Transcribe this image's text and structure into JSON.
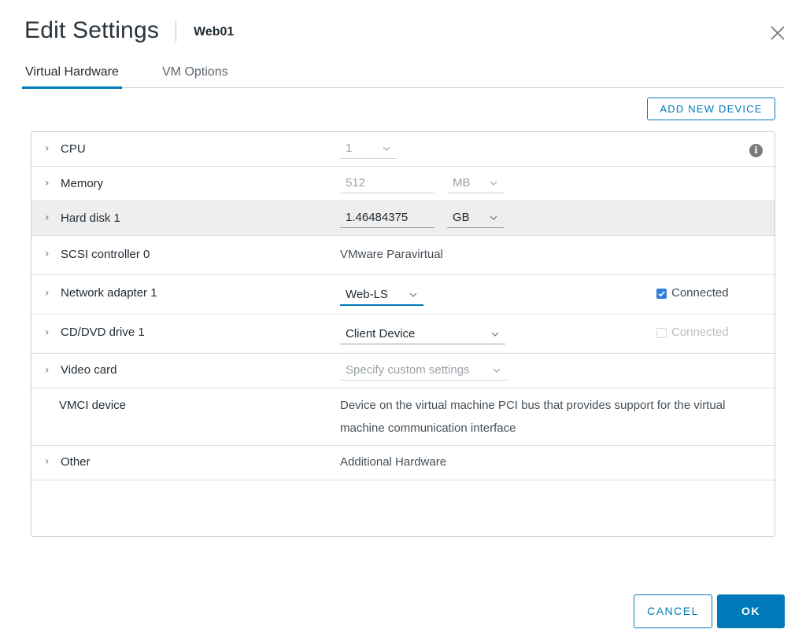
{
  "dialog": {
    "title": "Edit Settings",
    "vm_name": "Web01",
    "close_icon": "close-icon"
  },
  "tabs": [
    {
      "label": "Virtual Hardware",
      "active": true
    },
    {
      "label": "VM Options",
      "active": false
    }
  ],
  "toolbar": {
    "add_device_label": "ADD NEW DEVICE"
  },
  "hardware": {
    "cpu": {
      "label": "CPU",
      "value": "1"
    },
    "memory": {
      "label": "Memory",
      "value": "512",
      "unit": "MB"
    },
    "hard_disk": {
      "label": "Hard disk 1",
      "value": "1.46484375",
      "unit": "GB"
    },
    "scsi": {
      "label": "SCSI controller 0",
      "value": "VMware Paravirtual"
    },
    "network": {
      "label": "Network adapter 1",
      "value": "Web-LS",
      "connected_label": "Connected",
      "connected": true
    },
    "cdrom": {
      "label": "CD/DVD drive 1",
      "value": "Client Device",
      "connected_label": "Connected",
      "connected": false
    },
    "video": {
      "label": "Video card",
      "value": "Specify custom settings"
    },
    "vmci": {
      "label": "VMCI device",
      "description": "Device on the virtual machine PCI bus that provides support for the virtual machine communication interface"
    },
    "other": {
      "label": "Other",
      "value": "Additional Hardware"
    }
  },
  "footer": {
    "cancel_label": "CANCEL",
    "ok_label": "OK"
  },
  "colors": {
    "accent": "#0079b8",
    "checkbox": "#2f7fd6",
    "row_highlight": "#eeeeee"
  }
}
